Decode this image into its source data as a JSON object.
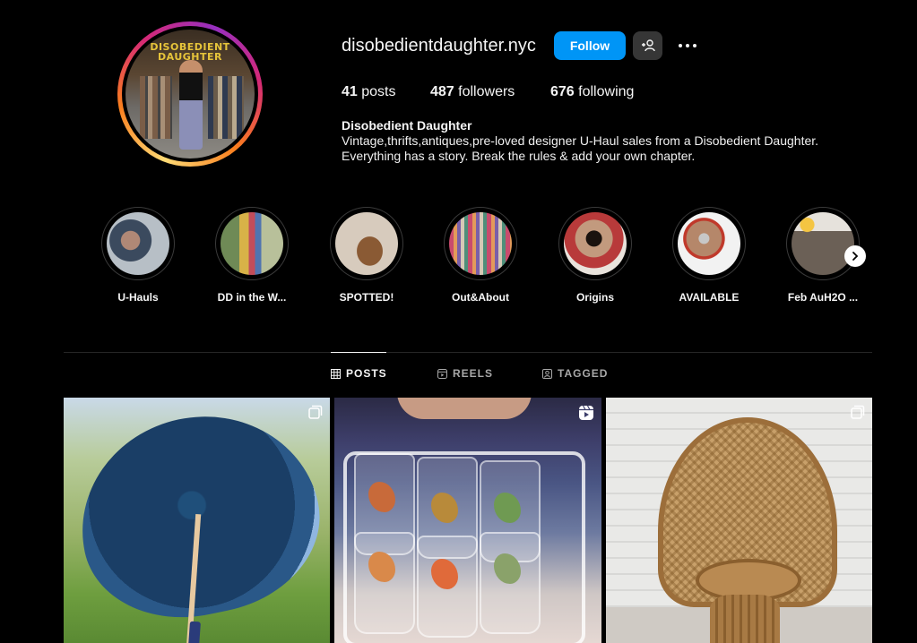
{
  "profile": {
    "avatar_sign_text": "DISOBEDIENT DAUGHTER",
    "username": "disobedientdaughter.nyc",
    "follow_label": "Follow",
    "stats": {
      "posts_count": "41",
      "posts_label": "posts",
      "followers_count": "487",
      "followers_label": "followers",
      "following_count": "676",
      "following_label": "following"
    },
    "bio": {
      "name": "Disobedient Daughter",
      "line1": "Vintage,thrifts,antiques,pre-loved designer U-Haul sales from a Disobedient Daughter.",
      "line2": "Everything has a story. Break the rules & add your own chapter."
    }
  },
  "highlights": [
    {
      "label": "U-Hauls"
    },
    {
      "label": "DD in the W..."
    },
    {
      "label": "SPOTTED!"
    },
    {
      "label": "Out&About"
    },
    {
      "label": "Origins"
    },
    {
      "label": "AVAILABLE"
    },
    {
      "label": "Feb AuH2O ..."
    }
  ],
  "tabs": [
    {
      "label": "POSTS",
      "icon": "grid-icon",
      "active": true
    },
    {
      "label": "REELS",
      "icon": "reels-icon",
      "active": false
    },
    {
      "label": "TAGGED",
      "icon": "tagged-icon",
      "active": false
    }
  ],
  "posts": [
    {
      "subject": "umbrella",
      "badge": "carousel-icon"
    },
    {
      "subject": "glasses",
      "badge": "reel-icon"
    },
    {
      "subject": "chair",
      "badge": "carousel-icon"
    }
  ],
  "colors": {
    "background": "#000000",
    "accent_blue": "#0095f6",
    "secondary_button": "#363636",
    "divider": "#262626",
    "muted_text": "#a8a8a8"
  }
}
